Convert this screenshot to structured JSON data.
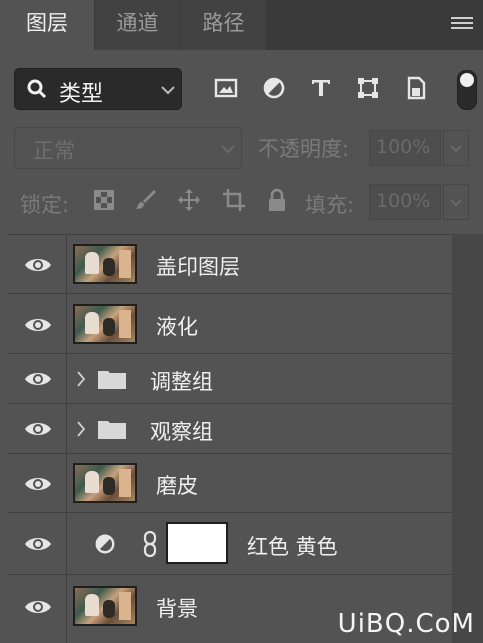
{
  "tabs": [
    {
      "label": "图层",
      "active": true
    },
    {
      "label": "通道",
      "active": false
    },
    {
      "label": "路径",
      "active": false
    }
  ],
  "filter": {
    "kind_label": "类型",
    "icons": [
      "image-filter-icon",
      "adjustment-filter-icon",
      "type-filter-icon",
      "shape-filter-icon",
      "smart-object-filter-icon",
      "filter-toggle-switch"
    ]
  },
  "blend": {
    "mode": "正常",
    "opacity_label": "不透明度:",
    "opacity_value": "100%"
  },
  "lock": {
    "label": "锁定:",
    "fill_label": "填充:",
    "fill_value": "100%",
    "icons": [
      "lock-transparent-icon",
      "lock-paint-icon",
      "lock-move-icon",
      "lock-artboard-icon",
      "lock-all-icon"
    ]
  },
  "layers": [
    {
      "name": "盖印图层",
      "type": "image",
      "visible": true
    },
    {
      "name": "液化",
      "type": "image",
      "visible": true
    },
    {
      "name": "调整组",
      "type": "group",
      "visible": true
    },
    {
      "name": "观察组",
      "type": "group",
      "visible": true
    },
    {
      "name": "磨皮",
      "type": "image",
      "visible": true
    },
    {
      "name": "红色 黄色",
      "type": "adjustment",
      "visible": true
    },
    {
      "name": "背景",
      "type": "image",
      "visible": true
    }
  ],
  "watermark": "UiBQ.CoM",
  "colors": {
    "panel": "#535353",
    "tabbar": "#3a3a3a",
    "field": "#2a2a2a",
    "text": "#f0f0f0"
  }
}
